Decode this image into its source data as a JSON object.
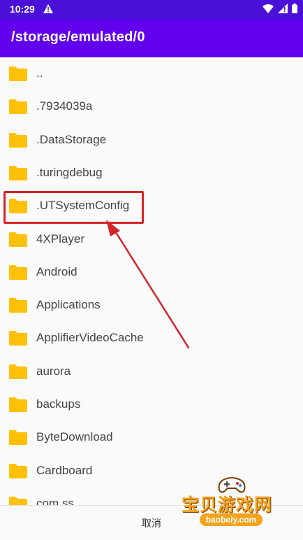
{
  "status_bar": {
    "time": "10:29"
  },
  "header": {
    "title": "/storage/emulated/0"
  },
  "folders": [
    {
      "label": ".."
    },
    {
      "label": ".7934039a"
    },
    {
      "label": ".DataStorage"
    },
    {
      "label": ".turingdebug"
    },
    {
      "label": ".UTSystemConfig"
    },
    {
      "label": "4XPlayer"
    },
    {
      "label": "Android"
    },
    {
      "label": "Applications"
    },
    {
      "label": "ApplifierVideoCache"
    },
    {
      "label": "aurora"
    },
    {
      "label": "backups"
    },
    {
      "label": "ByteDownload"
    },
    {
      "label": "Cardboard"
    },
    {
      "label": "com.ss"
    }
  ],
  "footer": {
    "cancel_label": "取消"
  },
  "watermark": {
    "title": "宝贝游戏网",
    "url": "baobeiy.com"
  },
  "colors": {
    "status_bar": "#4a10d8",
    "app_bar": "#6200ee",
    "folder": "#ffc107",
    "highlight": "#d4242a",
    "watermark": "#f4a21c"
  },
  "icons": {
    "folder": "folder-icon",
    "alert": "alert-triangle-icon",
    "wifi": "wifi-icon",
    "signal": "signal-icon",
    "battery": "battery-icon"
  }
}
